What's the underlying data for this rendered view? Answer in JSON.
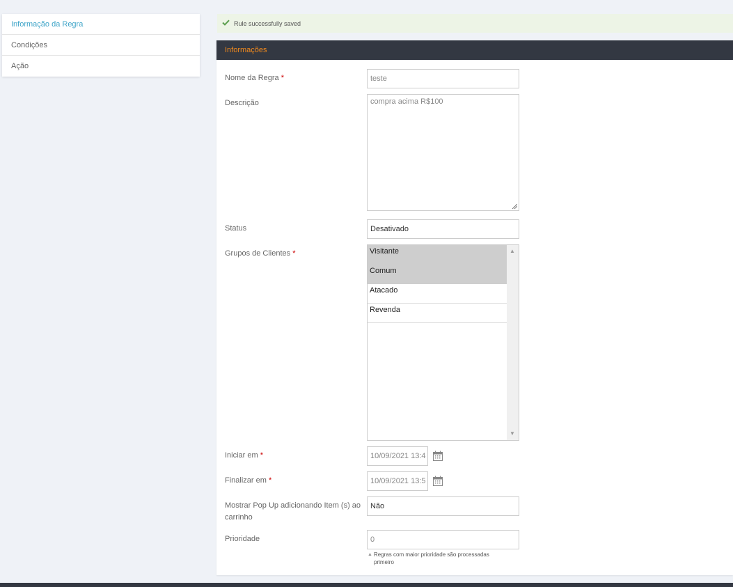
{
  "sidebar": {
    "items": [
      {
        "label": "Informação da Regra"
      },
      {
        "label": "Condições"
      },
      {
        "label": "Ação"
      }
    ]
  },
  "alert": {
    "message": "Rule successfully saved",
    "icon": "checkmark-icon"
  },
  "panel": {
    "title": "Informações"
  },
  "form": {
    "name": {
      "label": "Nome da Regra",
      "required": "*",
      "value": "teste"
    },
    "description": {
      "label": "Descrição",
      "value": "compra acima R$100"
    },
    "status": {
      "label": "Status",
      "value": "Desativado"
    },
    "customer_groups": {
      "label": "Grupos de Clientes",
      "required": "*",
      "options": [
        {
          "label": "Visitante",
          "selected": true
        },
        {
          "label": "Comum",
          "selected": true
        },
        {
          "label": "Atacado",
          "selected": false
        },
        {
          "label": "Revenda",
          "selected": false
        }
      ]
    },
    "start": {
      "label": "Iniciar em",
      "required": "*",
      "value": "10/09/2021 13:4"
    },
    "end": {
      "label": "Finalizar em",
      "required": "*",
      "value": "10/09/2021 13:5"
    },
    "popup": {
      "label": "Mostrar Pop Up adicionando Item (s) ao carrinho",
      "value": "Não"
    },
    "priority": {
      "label": "Prioridade",
      "value": "0",
      "note": "Regras com maior prioridade são processadas primeiro"
    }
  },
  "colors": {
    "accent": "#f38a1c",
    "link": "#3ea4c8",
    "header_bg": "#333842",
    "success_bg": "#edf4e6",
    "success_icon": "#5b9e4d",
    "required": "#cc0000"
  }
}
